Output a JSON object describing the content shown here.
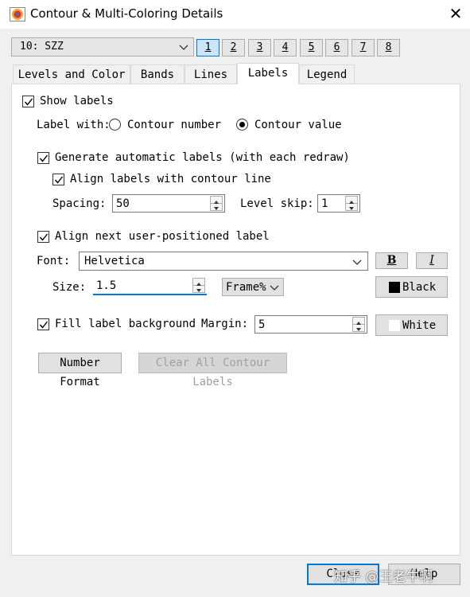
{
  "window": {
    "title": "Contour & Multi-Coloring Details",
    "close_glyph": "✕"
  },
  "plot_selector": {
    "value": "10: SZZ"
  },
  "plot_numbers": [
    "1",
    "2",
    "3",
    "4",
    "5",
    "6",
    "7",
    "8"
  ],
  "active_plot_number": "1",
  "tabs": [
    "Levels and Color",
    "Bands",
    "Lines",
    "Labels",
    "Legend"
  ],
  "active_tab": "Labels",
  "labels_tab": {
    "show_labels": {
      "label": "Show labels",
      "checked": true
    },
    "label_with": {
      "label": "Label with:",
      "options": [
        "Contour number",
        "Contour value"
      ],
      "selected": "Contour value"
    },
    "generate_automatic": {
      "label": "Generate automatic labels (with each redraw)",
      "checked": true
    },
    "align_with_line": {
      "label": "Align labels with contour line",
      "checked": true
    },
    "spacing": {
      "label": "Spacing:",
      "value": "50"
    },
    "level_skip": {
      "label": "Level skip:",
      "value": "1"
    },
    "align_next_user": {
      "label": "Align next user-positioned label",
      "checked": true
    },
    "font": {
      "label": "Font:",
      "value": "Helvetica"
    },
    "bold_label": "B",
    "italic_label": "I",
    "size": {
      "label": "Size:",
      "value": "1.5",
      "units": "Frame%"
    },
    "color_button": {
      "label": "Black",
      "swatch": "#000000"
    },
    "fill_background": {
      "label": "Fill label background",
      "checked": true
    },
    "margin": {
      "label": "Margin:",
      "value": "5"
    },
    "fill_color_button": {
      "label": "White",
      "swatch": "#ffffff"
    },
    "number_format_button": "Number Format",
    "clear_all_button": "Clear All Contour Labels"
  },
  "footer": {
    "close_button": "Close",
    "help_button": "Help"
  },
  "watermark": "知乎 @王老牛啊",
  "colors": {
    "accent": "#0078d7",
    "active_tab_fill": "#cce4f7"
  }
}
